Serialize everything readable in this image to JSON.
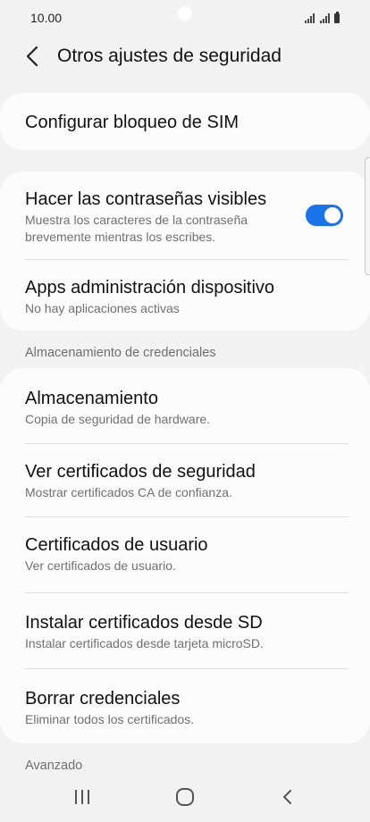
{
  "status_bar": {
    "time": "10.00"
  },
  "header": {
    "title": "Otros ajustes de seguridad"
  },
  "sim_lock": {
    "title": "Configurar bloqueo de SIM"
  },
  "passwords_visible": {
    "title": "Hacer las contraseñas visibles",
    "subtitle_line1": "Muestra los caracteres de la contraseña",
    "subtitle_line2": "brevemente mientras los escribes.",
    "enabled": true,
    "toggle_color": "#1a73e8"
  },
  "device_admin": {
    "title": "Apps administración dispositivo",
    "subtitle": "No hay aplicaciones activas"
  },
  "credentials_section": {
    "header": "Almacenamiento de credenciales",
    "items": [
      {
        "title": "Almacenamiento",
        "subtitle": "Copia de seguridad de hardware."
      },
      {
        "title": "Ver certificados de seguridad",
        "subtitle": "Mostrar certificados CA de confianza."
      },
      {
        "title": "Certificados de usuario",
        "subtitle": "Ver certificados de usuario."
      },
      {
        "title": "Instalar certificados desde SD",
        "subtitle": "Instalar certificados desde tarjeta microSD."
      },
      {
        "title": "Borrar credenciales",
        "subtitle": "Eliminar todos los certificados."
      }
    ]
  },
  "advanced_section": {
    "header": "Avanzado"
  },
  "nav_bar": {
    "icons": [
      "recents-icon",
      "home-icon",
      "back-icon"
    ]
  }
}
